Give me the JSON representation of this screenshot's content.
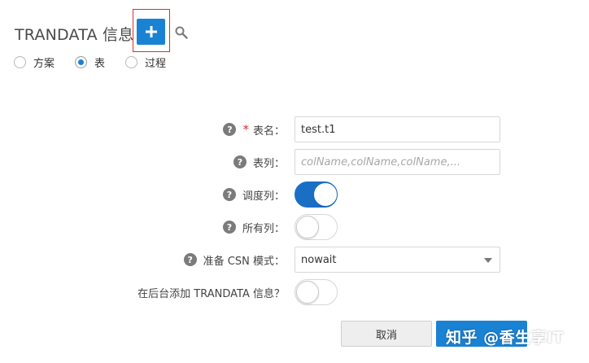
{
  "header": {
    "title": "TRANDATA 信息"
  },
  "toolbar": {
    "add_icon": "plus-icon",
    "search_icon": "search-icon"
  },
  "type_options": [
    {
      "label": "方案",
      "checked": false
    },
    {
      "label": "表",
      "checked": true
    },
    {
      "label": "过程",
      "checked": false
    }
  ],
  "form": {
    "table_name": {
      "label": "表名：",
      "required": true,
      "value": "test.t1"
    },
    "table_columns": {
      "label": "表列：",
      "placeholder": "colName,colName,colName,..."
    },
    "scheduling_columns": {
      "label": "调度列：",
      "on": true
    },
    "all_columns": {
      "label": "所有列：",
      "on": false
    },
    "prepare_csn_mode": {
      "label": "准备 CSN 模式：",
      "value": "nowait"
    },
    "add_in_background": {
      "label": "在后台添加 TRANDATA 信息？",
      "on": false
    }
  },
  "buttons": {
    "cancel": "取消",
    "ok": ""
  },
  "watermark": "知乎 @香生享IT",
  "colors": {
    "accent": "#1a82d3",
    "highlight_box": "#d9302b"
  }
}
